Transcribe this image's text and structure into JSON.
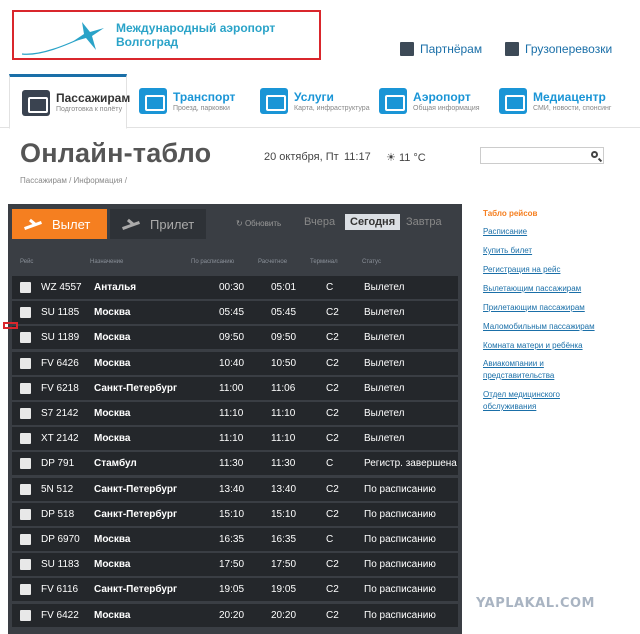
{
  "header": {
    "logo_line1": "Международный аэропорт",
    "logo_line2": "Волгоград",
    "links": [
      {
        "label": "Партнёрам"
      },
      {
        "label": "Грузоперевозки"
      }
    ]
  },
  "nav": [
    {
      "title": "Пассажирам",
      "sub": "Подготовка к полёту"
    },
    {
      "title": "Транспорт",
      "sub": "Проезд, парковки"
    },
    {
      "title": "Услуги",
      "sub": "Карта, инфраструктура"
    },
    {
      "title": "Аэропорт",
      "sub": "Общая информация"
    },
    {
      "title": "Медиацентр",
      "sub": "СМИ, новости, спонсинг"
    }
  ],
  "page": {
    "title": "Онлайн-табло",
    "date": "20 октября, Пт",
    "time": "11:17",
    "weather": "11 °C",
    "search_placeholder": "",
    "breadcrumb": "Пассажирам / Информация /"
  },
  "board": {
    "tab_departure": "Вылет",
    "tab_arrival": "Прилет",
    "refresh": "Обновить",
    "days": [
      "Вчера",
      "Сегодня",
      "Завтра"
    ],
    "columns": [
      "Рейс",
      "Назначение",
      "По расписанию",
      "Расчетное",
      "Терминал",
      "Статус"
    ],
    "rows": [
      {
        "flight": "WZ 4557",
        "dest": "Анталья",
        "sched": "00:30",
        "est": "05:01",
        "term": "C",
        "status": "Вылетел"
      },
      {
        "flight": "SU 1185",
        "dest": "Москва",
        "sched": "05:45",
        "est": "05:45",
        "term": "C2",
        "status": "Вылетел"
      },
      {
        "flight": "SU 1189",
        "dest": "Москва",
        "sched": "09:50",
        "est": "09:50",
        "term": "C2",
        "status": "Вылетел"
      },
      {
        "flight": "FV 6426",
        "dest": "Москва",
        "sched": "10:40",
        "est": "10:50",
        "term": "C2",
        "status": "Вылетел"
      },
      {
        "flight": "FV 6218",
        "dest": "Санкт-Петербург",
        "sched": "11:00",
        "est": "11:06",
        "term": "C2",
        "status": "Вылетел"
      },
      {
        "flight": "S7 2142",
        "dest": "Москва",
        "sched": "11:10",
        "est": "11:10",
        "term": "C2",
        "status": "Вылетел"
      },
      {
        "flight": "XT 2142",
        "dest": "Москва",
        "sched": "11:10",
        "est": "11:10",
        "term": "C2",
        "status": "Вылетел"
      },
      {
        "flight": "DP 791",
        "dest": "Стамбул",
        "sched": "11:30",
        "est": "11:30",
        "term": "C",
        "status": "Регистр. завершена"
      },
      {
        "flight": "5N 512",
        "dest": "Санкт-Петербург",
        "sched": "13:40",
        "est": "13:40",
        "term": "C2",
        "status": "По расписанию"
      },
      {
        "flight": "DP 518",
        "dest": "Санкт-Петербург",
        "sched": "15:10",
        "est": "15:10",
        "term": "C2",
        "status": "По расписанию"
      },
      {
        "flight": "DP 6970",
        "dest": "Москва",
        "sched": "16:35",
        "est": "16:35",
        "term": "C",
        "status": "По расписанию"
      },
      {
        "flight": "SU 1183",
        "dest": "Москва",
        "sched": "17:50",
        "est": "17:50",
        "term": "C2",
        "status": "По расписанию"
      },
      {
        "flight": "FV 6116",
        "dest": "Санкт-Петербург",
        "sched": "19:05",
        "est": "19:05",
        "term": "C2",
        "status": "По расписанию"
      },
      {
        "flight": "FV 6422",
        "dest": "Москва",
        "sched": "20:20",
        "est": "20:20",
        "term": "C2",
        "status": "По расписанию"
      }
    ]
  },
  "sidebar": [
    "Табло рейсов",
    "Расписание",
    "Купить билет",
    "Регистрация на рейс",
    "Вылетающим пассажирам",
    "Прилетающим пассажирам",
    "Маломобильным пассажирам",
    "Комната матери и ребёнка",
    "Авиакомпании и представительства",
    "Отдел медицинского обслуживания"
  ],
  "watermark": "YAPLAKAL.COM",
  "colors": {
    "accent": "#f57f20",
    "link": "#1a6fa8",
    "board_bg": "#3a3e44",
    "row_bg": "#24272b",
    "highlight": "#d9262c"
  }
}
